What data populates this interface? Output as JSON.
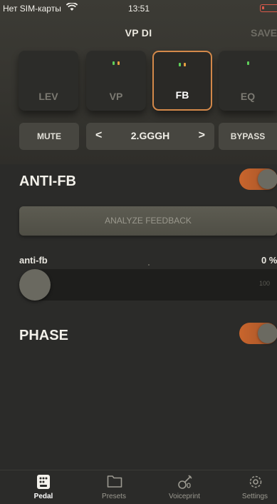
{
  "status_bar": {
    "carrier": "Нет SIM-карты",
    "time": "13:51"
  },
  "header": {
    "title": "VP DI",
    "save_label": "SAVE"
  },
  "modules": [
    {
      "label": "LEV",
      "active": false,
      "leds": []
    },
    {
      "label": "VP",
      "active": false,
      "leds": [
        "green",
        "orange"
      ]
    },
    {
      "label": "FB",
      "active": true,
      "leds": [
        "green",
        "orange"
      ]
    },
    {
      "label": "EQ",
      "active": false,
      "leds": [
        "green"
      ]
    }
  ],
  "controls": {
    "mute_label": "MUTE",
    "prev_glyph": "<",
    "preset_name": "2.GGGH",
    "next_glyph": ">",
    "bypass_label": "BYPASS"
  },
  "anti_fb": {
    "title": "ANTI-FB",
    "enabled": true,
    "analyze_label": "ANALYZE FEEDBACK",
    "param_label": "anti-fb",
    "param_value": "0 %",
    "level_percent": 0,
    "slider_max": "100"
  },
  "phase": {
    "title": "PHASE",
    "enabled": true
  },
  "tabs": [
    {
      "label": "Pedal",
      "icon": "pedal-icon",
      "active": true
    },
    {
      "label": "Presets",
      "icon": "folder-icon",
      "active": false
    },
    {
      "label": "Voiceprint",
      "icon": "guitar-mic-icon",
      "active": false
    },
    {
      "label": "Settings",
      "icon": "gear-icon",
      "active": false
    }
  ],
  "colors": {
    "accent": "#d4894a",
    "toggle_on": "#c9652c",
    "background": "#2b2b29"
  }
}
